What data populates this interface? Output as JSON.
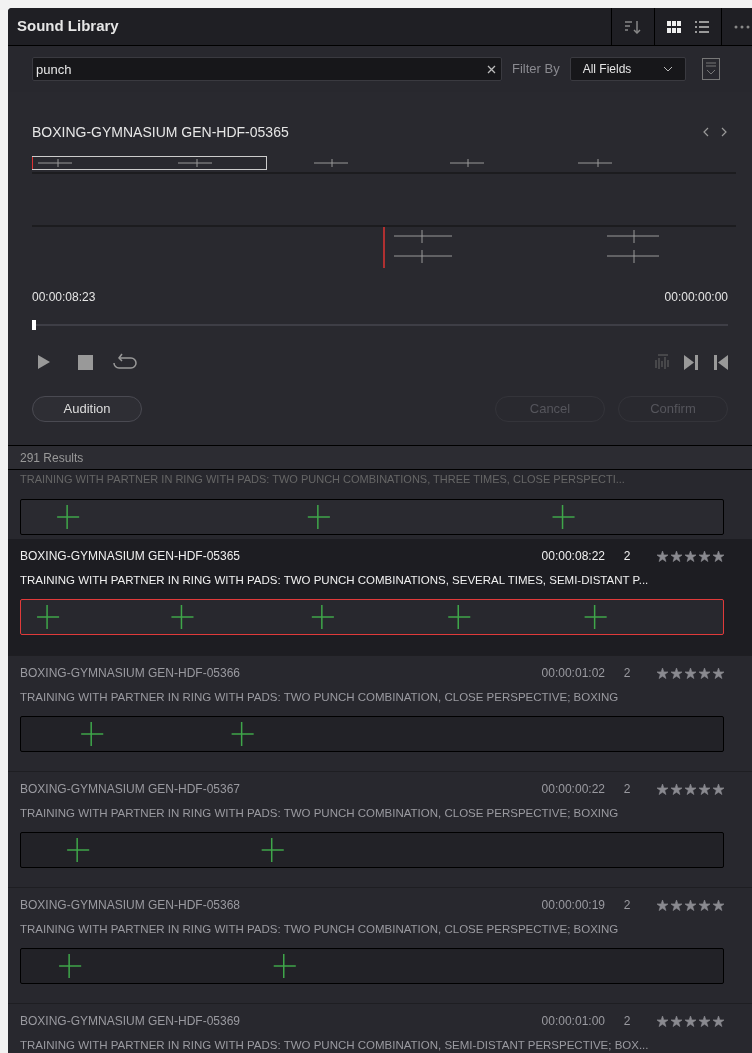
{
  "window": {
    "title": "Sound Library"
  },
  "search": {
    "value": "punch",
    "filter_label": "Filter By",
    "filter_value": "All Fields"
  },
  "preview": {
    "title": "BOXING-GYMNASIUM GEN-HDF-05365",
    "time_start": "00:00:08:23",
    "time_end": "00:00:00:00",
    "level": 0.0,
    "buttons": [
      "Audition",
      "Cancel",
      "Confirm"
    ]
  },
  "results": {
    "count": "291 Results",
    "partial_description": "TRAINING WITH PARTNER IN RING WITH PADS: TWO PUNCH COMBINATIONS, THREE TIMES, CLOSE PERSPECTI...",
    "rows": [
      {
        "name": "BOXING-GYMNASIUM GEN-HDF-05365",
        "duration": "00:00:08:22",
        "channels": "2",
        "stars": 5,
        "description": "TRAINING WITH PARTNER IN RING WITH PADS: TWO PUNCH COMBINATIONS, SEVERAL TIMES, SEMI-DISTANT P...",
        "selected": true
      },
      {
        "name": "BOXING-GYMNASIUM GEN-HDF-05366",
        "duration": "00:00:01:02",
        "channels": "2",
        "stars": 5,
        "description": "TRAINING WITH PARTNER IN RING WITH PADS: TWO PUNCH COMBINATION, CLOSE PERSPECTIVE; BOXING",
        "selected": false
      },
      {
        "name": "BOXING-GYMNASIUM GEN-HDF-05367",
        "duration": "00:00:00:22",
        "channels": "2",
        "stars": 5,
        "description": "TRAINING WITH PARTNER IN RING WITH PADS: TWO PUNCH COMBINATION, CLOSE PERSPECTIVE; BOXING",
        "selected": false
      },
      {
        "name": "BOXING-GYMNASIUM GEN-HDF-05368",
        "duration": "00:00:00:19",
        "channels": "2",
        "stars": 5,
        "description": "TRAINING WITH PARTNER IN RING WITH PADS: TWO PUNCH COMBINATION, CLOSE PERSPECTIVE; BOXING",
        "selected": false
      },
      {
        "name": "BOXING-GYMNASIUM GEN-HDF-05369",
        "duration": "00:00:01:00",
        "channels": "2",
        "stars": 5,
        "description": "TRAINING WITH PARTNER IN RING WITH PADS: TWO PUNCH COMBINATION, SEMI-DISTANT PERSPECTIVE; BOX...",
        "selected": false
      }
    ]
  }
}
